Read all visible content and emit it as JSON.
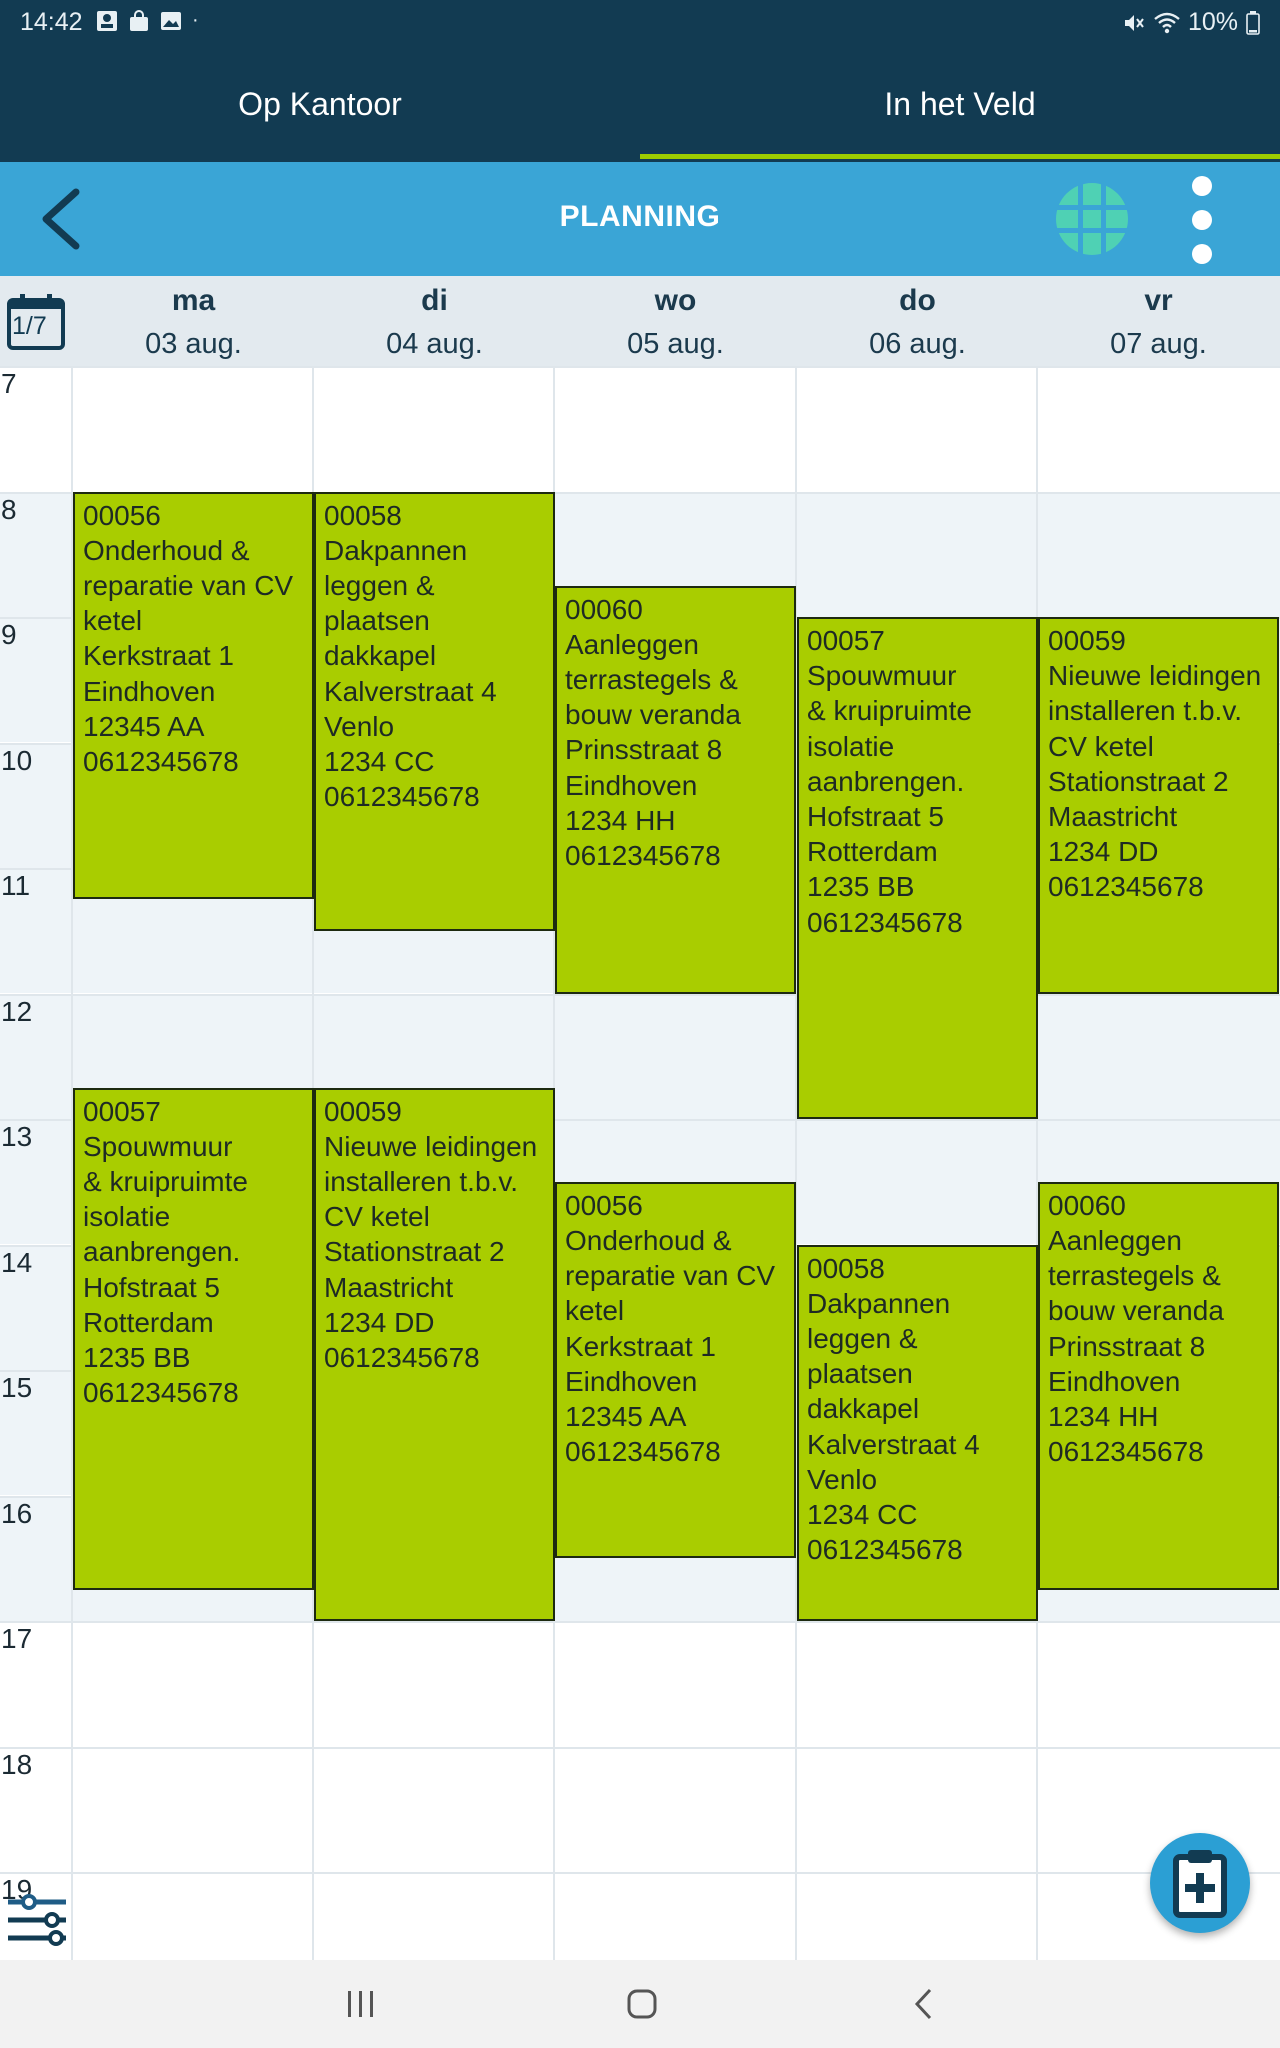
{
  "status_bar": {
    "time": "14:42",
    "battery": "10%"
  },
  "tabs": [
    {
      "label": "Op Kantoor"
    },
    {
      "label": "In het Veld"
    }
  ],
  "app_bar": {
    "title": "PLANNING"
  },
  "week_badge": "1/7",
  "colors": {
    "status_bg": "#123b52",
    "appbar_bg": "#3aa5d6",
    "appointment_bg": "#a9cd00",
    "tab_indicator": "#9ccc00",
    "grid_icon": "#4fd1b4"
  },
  "days": [
    {
      "name": "ma",
      "date": "03 aug."
    },
    {
      "name": "di",
      "date": "04 aug."
    },
    {
      "name": "wo",
      "date": "05 aug."
    },
    {
      "name": "do",
      "date": "06 aug."
    },
    {
      "name": "vr",
      "date": "07 aug."
    }
  ],
  "hours": [
    "7",
    "8",
    "9",
    "10",
    "11",
    "12",
    "13",
    "14",
    "15",
    "16",
    "17",
    "18",
    "19"
  ],
  "appointments": [
    {
      "day": 0,
      "start": 8.0,
      "end": 11.25,
      "text": "00056\nOnderhoud &\nreparatie van CV\nketel\nKerkstraat 1\nEindhoven\n12345 AA\n0612345678"
    },
    {
      "day": 1,
      "start": 8.0,
      "end": 11.5,
      "text": "00058\nDakpannen\nleggen &\nplaatsen\ndakkapel\nKalverstraat 4\nVenlo\n1234 CC\n0612345678"
    },
    {
      "day": 2,
      "start": 8.75,
      "end": 12.0,
      "text": "00060\nAanleggen\nterrastegels &\nbouw veranda\nPrinsstraat 8\nEindhoven\n1234 HH\n0612345678"
    },
    {
      "day": 3,
      "start": 9.0,
      "end": 13.0,
      "text": "00057\nSpouwmuur\n& kruipruimte\nisolatie\naanbrengen.\nHofstraat 5\nRotterdam\n1235 BB\n0612345678"
    },
    {
      "day": 4,
      "start": 9.0,
      "end": 12.0,
      "text": "00059\nNieuwe leidingen\ninstalleren t.b.v.\nCV ketel\nStationstraat 2\nMaastricht\n1234 DD\n0612345678"
    },
    {
      "day": 0,
      "start": 12.75,
      "end": 16.75,
      "text": "00057\nSpouwmuur\n& kruipruimte\nisolatie\naanbrengen.\nHofstraat 5\nRotterdam\n1235 BB\n0612345678"
    },
    {
      "day": 1,
      "start": 12.75,
      "end": 17.0,
      "text": "00059\nNieuwe leidingen\ninstalleren t.b.v.\nCV ketel\nStationstraat 2\nMaastricht\n1234 DD\n0612345678"
    },
    {
      "day": 2,
      "start": 13.5,
      "end": 16.5,
      "text": "00056\nOnderhoud &\nreparatie van CV\nketel\nKerkstraat 1\nEindhoven\n12345 AA\n0612345678"
    },
    {
      "day": 3,
      "start": 14.0,
      "end": 17.0,
      "text": "00058\nDakpannen\nleggen &\nplaatsen\ndakkapel\nKalverstraat 4\nVenlo\n1234 CC\n0612345678"
    },
    {
      "day": 4,
      "start": 13.5,
      "end": 16.75,
      "text": "00060\nAanleggen\nterrastegels &\nbouw veranda\nPrinsstraat 8\nEindhoven\n1234 HH\n0612345678"
    }
  ]
}
